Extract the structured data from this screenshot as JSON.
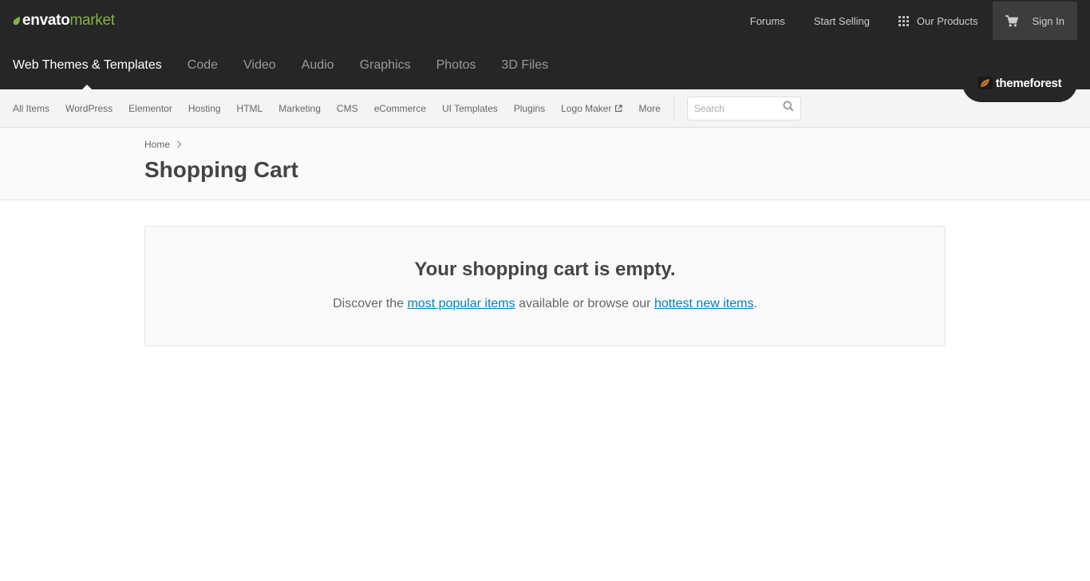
{
  "brand": {
    "part1": "envato",
    "part2": "market",
    "accent": "#82b541"
  },
  "top_links": {
    "forums": "Forums",
    "start_selling": "Start Selling",
    "our_products": "Our Products",
    "sign_in": "Sign In"
  },
  "categories": [
    {
      "label": "Web Themes & Templates",
      "active": true
    },
    {
      "label": "Code"
    },
    {
      "label": "Video"
    },
    {
      "label": "Audio"
    },
    {
      "label": "Graphics"
    },
    {
      "label": "Photos"
    },
    {
      "label": "3D Files"
    }
  ],
  "site_badge": {
    "label": "themeforest"
  },
  "subnav": {
    "items": [
      "All Items",
      "WordPress",
      "Elementor",
      "Hosting",
      "HTML",
      "Marketing",
      "CMS",
      "eCommerce",
      "UI Templates",
      "Plugins",
      "Logo Maker",
      "More"
    ],
    "search_placeholder": "Search"
  },
  "breadcrumb": {
    "home": "Home"
  },
  "page": {
    "title": "Shopping Cart"
  },
  "empty_cart": {
    "title": "Your shopping cart is empty.",
    "text_before": "Discover the ",
    "link_popular": "most popular items",
    "text_middle": " available or browse our ",
    "link_new": "hottest new items",
    "text_after": "."
  },
  "icons": {
    "leaf": "envato-leaf-icon",
    "grid": "grid-icon",
    "cart": "cart-icon",
    "external": "external-link-icon",
    "search": "search-icon",
    "chevron": "chevron-right-icon"
  }
}
